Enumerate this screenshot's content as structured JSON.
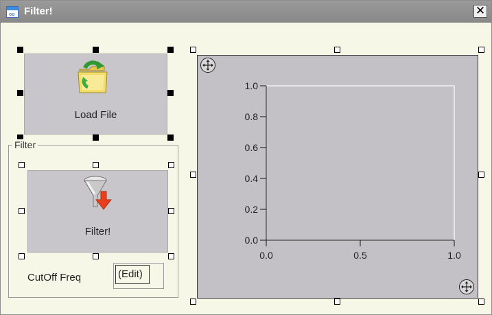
{
  "window": {
    "title": "Filter!",
    "close_glyph": "✕",
    "icon_name": "window-icon",
    "icon_text": "oo"
  },
  "load_button": {
    "label": "Load File",
    "icon_name": "folder-refresh-icon"
  },
  "filter_group": {
    "label": "Filter"
  },
  "filter_button": {
    "label": "Filter!",
    "icon_name": "funnel-icon"
  },
  "cutoff": {
    "label": "CutOff Freq",
    "value": "(Edit)"
  },
  "colors": {
    "background": "#f7f7e7",
    "titlebar": "#8f8f8f",
    "plot_bg": "#c3c1c6",
    "button_bg": "#c8c6cb"
  },
  "chart_data": {
    "type": "line",
    "series": [],
    "xlim": [
      0.0,
      1.0
    ],
    "ylim": [
      0.0,
      1.0
    ],
    "xticks": [
      0.0,
      0.5,
      1.0
    ],
    "yticks": [
      0.0,
      0.2,
      0.4,
      0.6,
      0.8,
      1.0
    ],
    "xtick_labels": [
      "0.0",
      "0.5",
      "1.0"
    ],
    "ytick_labels": [
      "0.0",
      "0.2",
      "0.4",
      "0.6",
      "0.8",
      "1.0"
    ],
    "grid": false
  }
}
